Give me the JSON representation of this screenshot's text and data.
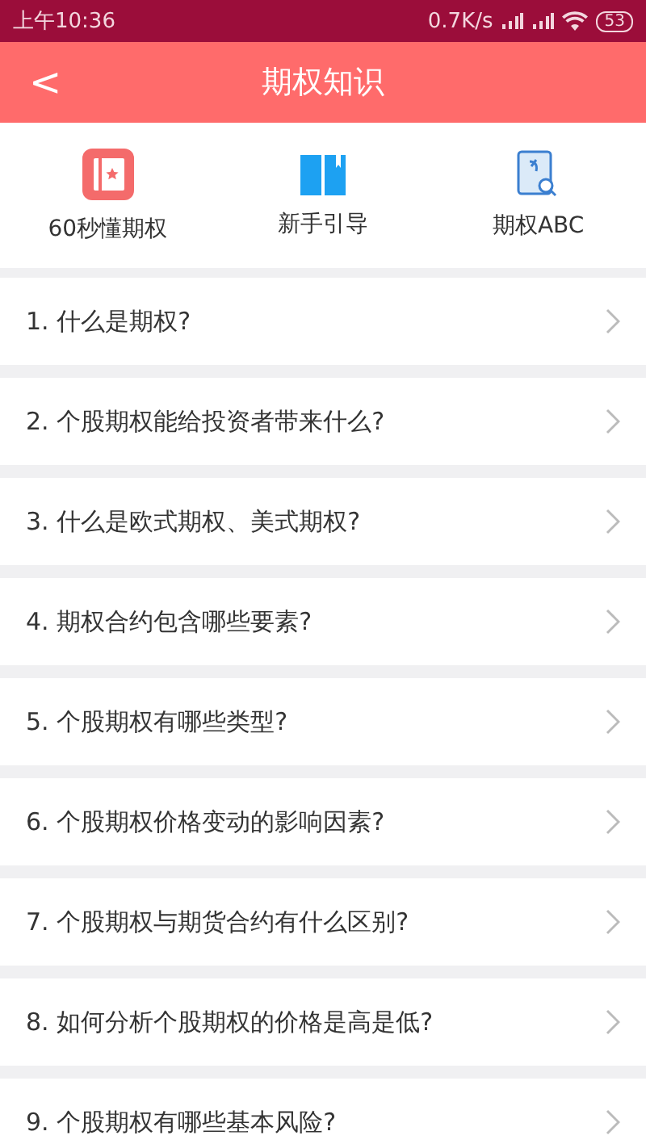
{
  "status_bar": {
    "time": "上午10:36",
    "speed": "0.7K/s",
    "battery": "53"
  },
  "header": {
    "back": "<",
    "title": "期权知识"
  },
  "shortcuts": [
    {
      "label": "60秒懂期权"
    },
    {
      "label": "新手引导"
    },
    {
      "label": "期权ABC"
    }
  ],
  "questions": [
    {
      "text": "1. 什么是期权?"
    },
    {
      "text": "2. 个股期权能给投资者带来什么?"
    },
    {
      "text": "3. 什么是欧式期权、美式期权?"
    },
    {
      "text": "4. 期权合约包含哪些要素?"
    },
    {
      "text": "5. 个股期权有哪些类型?"
    },
    {
      "text": "6. 个股期权价格变动的影响因素?"
    },
    {
      "text": "7. 个股期权与期货合约有什么区别?"
    },
    {
      "text": "8. 如何分析个股期权的价格是高是低?"
    },
    {
      "text": "9. 个股期权有哪些基本风险?"
    }
  ]
}
